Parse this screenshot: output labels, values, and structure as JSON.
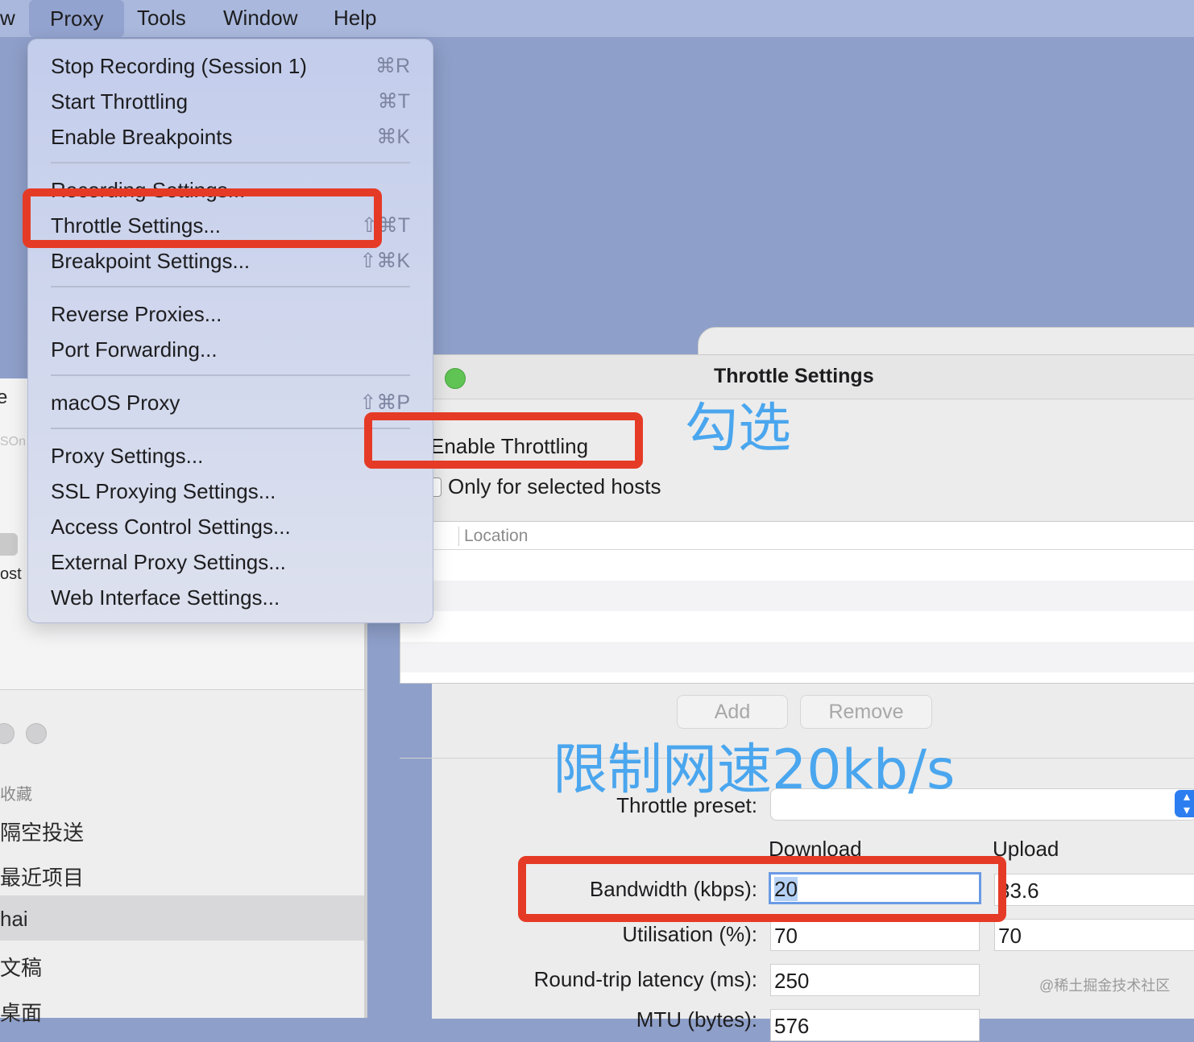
{
  "menubar": {
    "cut_item": "w",
    "proxy": "Proxy",
    "tools": "Tools",
    "window": "Window",
    "help": "Help"
  },
  "proxy_menu": {
    "stop_recording": "Stop Recording (Session 1)",
    "stop_recording_sc": "⌘R",
    "start_throttling": "Start Throttling",
    "start_throttling_sc": "⌘T",
    "enable_breakpoints": "Enable Breakpoints",
    "enable_breakpoints_sc": "⌘K",
    "recording_settings": "Recording Settings...",
    "throttle_settings": "Throttle Settings...",
    "throttle_settings_sc": "⇧⌘T",
    "breakpoint_settings": "Breakpoint Settings...",
    "breakpoint_settings_sc": "⇧⌘K",
    "reverse_proxies": "Reverse Proxies...",
    "port_forwarding": "Port Forwarding...",
    "macos_proxy": "macOS Proxy",
    "macos_proxy_sc": "⇧⌘P",
    "proxy_settings": "Proxy Settings...",
    "ssl_proxying_settings": "SSL Proxying Settings...",
    "access_control_settings": "Access Control Settings...",
    "external_proxy_settings": "External Proxy Settings...",
    "web_interface_settings": "Web Interface Settings..."
  },
  "background_window": {
    "cut_e": "e",
    "cut_son": "SOn",
    "cut_ost": "ost",
    "favorites": "收藏",
    "airdrop": "隔空投送",
    "recents": "最近项目",
    "user": "hai",
    "documents": "文稿",
    "desktop": "桌面"
  },
  "throttle_dialog": {
    "title": "Throttle Settings",
    "enable_throttling": "Enable Throttling",
    "only_selected_hosts": "Only for selected hosts",
    "location_header": "Location",
    "add_button": "Add",
    "remove_button": "Remove",
    "throttle_preset_label": "Throttle preset:",
    "throttle_preset_value": "",
    "download_header": "Download",
    "upload_header": "Upload",
    "bandwidth_label": "Bandwidth (kbps):",
    "bandwidth_download": "20",
    "bandwidth_upload": "33.6",
    "utilisation_label": "Utilisation (%):",
    "utilisation_download": "70",
    "utilisation_upload": "70",
    "latency_label": "Round-trip latency (ms):",
    "latency_download": "250",
    "mtu_label": "MTU (bytes):",
    "mtu_download": "576"
  },
  "annotations": {
    "check_note": "勾选",
    "limit_note": "限制网速20kb/s",
    "watermark": "@稀土掘金技术社区"
  },
  "colors": {
    "highlight_red": "#e53b26",
    "annotation_blue": "#4aa6ee",
    "menu_bg": "#c9d2ec"
  }
}
